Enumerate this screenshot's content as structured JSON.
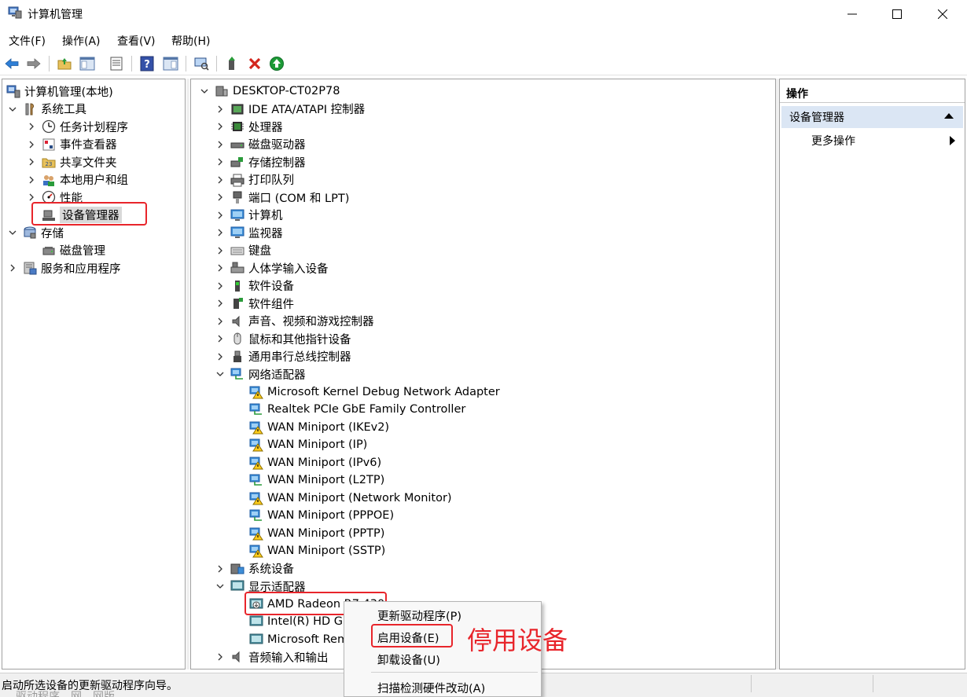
{
  "window": {
    "title": "计算机管理",
    "icon": "computer-management-icon"
  },
  "menu": [
    "文件(F)",
    "操作(A)",
    "查看(V)",
    "帮助(H)"
  ],
  "left_tree": [
    {
      "label": "计算机管理(本地)",
      "icon": "computer-management-icon",
      "level": 0,
      "chevron": "none"
    },
    {
      "label": "系统工具",
      "icon": "tools-icon",
      "level": 1,
      "chevron": "expanded"
    },
    {
      "label": "任务计划程序",
      "icon": "clock-icon",
      "level": 2,
      "chevron": "collapsed"
    },
    {
      "label": "事件查看器",
      "icon": "event-viewer-icon",
      "level": 2,
      "chevron": "collapsed"
    },
    {
      "label": "共享文件夹",
      "icon": "shared-folder-icon",
      "level": 2,
      "chevron": "collapsed"
    },
    {
      "label": "本地用户和组",
      "icon": "users-icon",
      "level": 2,
      "chevron": "collapsed"
    },
    {
      "label": "性能",
      "icon": "performance-icon",
      "level": 2,
      "chevron": "collapsed"
    },
    {
      "label": "设备管理器",
      "icon": "device-manager-icon",
      "level": 2,
      "chevron": "none",
      "selected": true
    },
    {
      "label": "存储",
      "icon": "storage-icon",
      "level": 1,
      "chevron": "expanded"
    },
    {
      "label": "磁盘管理",
      "icon": "disk-management-icon",
      "level": 2,
      "chevron": "none"
    },
    {
      "label": "服务和应用程序",
      "icon": "services-icon",
      "level": 1,
      "chevron": "collapsed"
    }
  ],
  "device_tree": {
    "root": "DESKTOP-CT02P78",
    "items": [
      {
        "label": "IDE ATA/ATAPI 控制器",
        "icon": "ide-controller-icon",
        "chevron": "collapsed",
        "level": 1
      },
      {
        "label": "处理器",
        "icon": "processor-icon",
        "chevron": "collapsed",
        "level": 1
      },
      {
        "label": "磁盘驱动器",
        "icon": "disk-drive-icon",
        "chevron": "collapsed",
        "level": 1
      },
      {
        "label": "存储控制器",
        "icon": "storage-controller-icon",
        "chevron": "collapsed",
        "level": 1
      },
      {
        "label": "打印队列",
        "icon": "printer-icon",
        "chevron": "collapsed",
        "level": 1
      },
      {
        "label": "端口 (COM 和 LPT)",
        "icon": "port-icon",
        "chevron": "collapsed",
        "level": 1
      },
      {
        "label": "计算机",
        "icon": "monitor-icon",
        "chevron": "collapsed",
        "level": 1
      },
      {
        "label": "监视器",
        "icon": "monitor-icon",
        "chevron": "collapsed",
        "level": 1
      },
      {
        "label": "键盘",
        "icon": "keyboard-icon",
        "chevron": "collapsed",
        "level": 1
      },
      {
        "label": "人体学输入设备",
        "icon": "hid-icon",
        "chevron": "collapsed",
        "level": 1
      },
      {
        "label": "软件设备",
        "icon": "software-device-icon",
        "chevron": "collapsed",
        "level": 1
      },
      {
        "label": "软件组件",
        "icon": "software-component-icon",
        "chevron": "collapsed",
        "level": 1
      },
      {
        "label": "声音、视频和游戏控制器",
        "icon": "speaker-icon",
        "chevron": "collapsed",
        "level": 1
      },
      {
        "label": "鼠标和其他指针设备",
        "icon": "mouse-icon",
        "chevron": "collapsed",
        "level": 1
      },
      {
        "label": "通用串行总线控制器",
        "icon": "usb-icon",
        "chevron": "collapsed",
        "level": 1
      },
      {
        "label": "网络适配器",
        "icon": "network-adapter-icon",
        "chevron": "expanded",
        "level": 1
      },
      {
        "label": "Microsoft Kernel Debug Network Adapter",
        "icon": "network-warning-icon",
        "chevron": "none",
        "level": 2
      },
      {
        "label": "Realtek PCIe GbE Family Controller",
        "icon": "network-adapter-icon",
        "chevron": "none",
        "level": 2
      },
      {
        "label": "WAN Miniport (IKEv2)",
        "icon": "network-warning-icon",
        "chevron": "none",
        "level": 2
      },
      {
        "label": "WAN Miniport (IP)",
        "icon": "network-warning-icon",
        "chevron": "none",
        "level": 2
      },
      {
        "label": "WAN Miniport (IPv6)",
        "icon": "network-warning-icon",
        "chevron": "none",
        "level": 2
      },
      {
        "label": "WAN Miniport (L2TP)",
        "icon": "network-adapter-icon",
        "chevron": "none",
        "level": 2
      },
      {
        "label": "WAN Miniport (Network Monitor)",
        "icon": "network-warning-icon",
        "chevron": "none",
        "level": 2
      },
      {
        "label": "WAN Miniport (PPPOE)",
        "icon": "network-adapter-icon",
        "chevron": "none",
        "level": 2
      },
      {
        "label": "WAN Miniport (PPTP)",
        "icon": "network-warning-icon",
        "chevron": "none",
        "level": 2
      },
      {
        "label": "WAN Miniport (SSTP)",
        "icon": "network-warning-icon",
        "chevron": "none",
        "level": 2
      },
      {
        "label": "系统设备",
        "icon": "system-device-icon",
        "chevron": "collapsed",
        "level": 1
      },
      {
        "label": "显示适配器",
        "icon": "display-adapter-icon",
        "chevron": "expanded",
        "level": 1
      },
      {
        "label": "AMD Radeon R7 430",
        "icon": "display-disabled-icon",
        "chevron": "none",
        "level": 2
      },
      {
        "label": "Intel(R) HD Graphics",
        "icon": "display-adapter-icon",
        "chevron": "none",
        "level": 2
      },
      {
        "label": "Microsoft Remote Display Adapter",
        "icon": "display-adapter-icon",
        "chevron": "none",
        "level": 2
      },
      {
        "label": "音频输入和输出",
        "icon": "speaker-icon",
        "chevron": "collapsed",
        "level": 1
      }
    ]
  },
  "actions": {
    "header": "操作",
    "section": "设备管理器",
    "more": "更多操作"
  },
  "context_menu": [
    "更新驱动程序(P)",
    "启用设备(E)",
    "卸载设备(U)",
    "扫描检测硬件改动(A)"
  ],
  "annotation": "停用设备",
  "status": "启动所选设备的更新驱动程序向导。",
  "cut_text": "驱动程序、网、网版。",
  "colors": {
    "highlight": "#e8252b",
    "selected": "#d9d9d9",
    "actions_sub": "#dbe6f4"
  }
}
